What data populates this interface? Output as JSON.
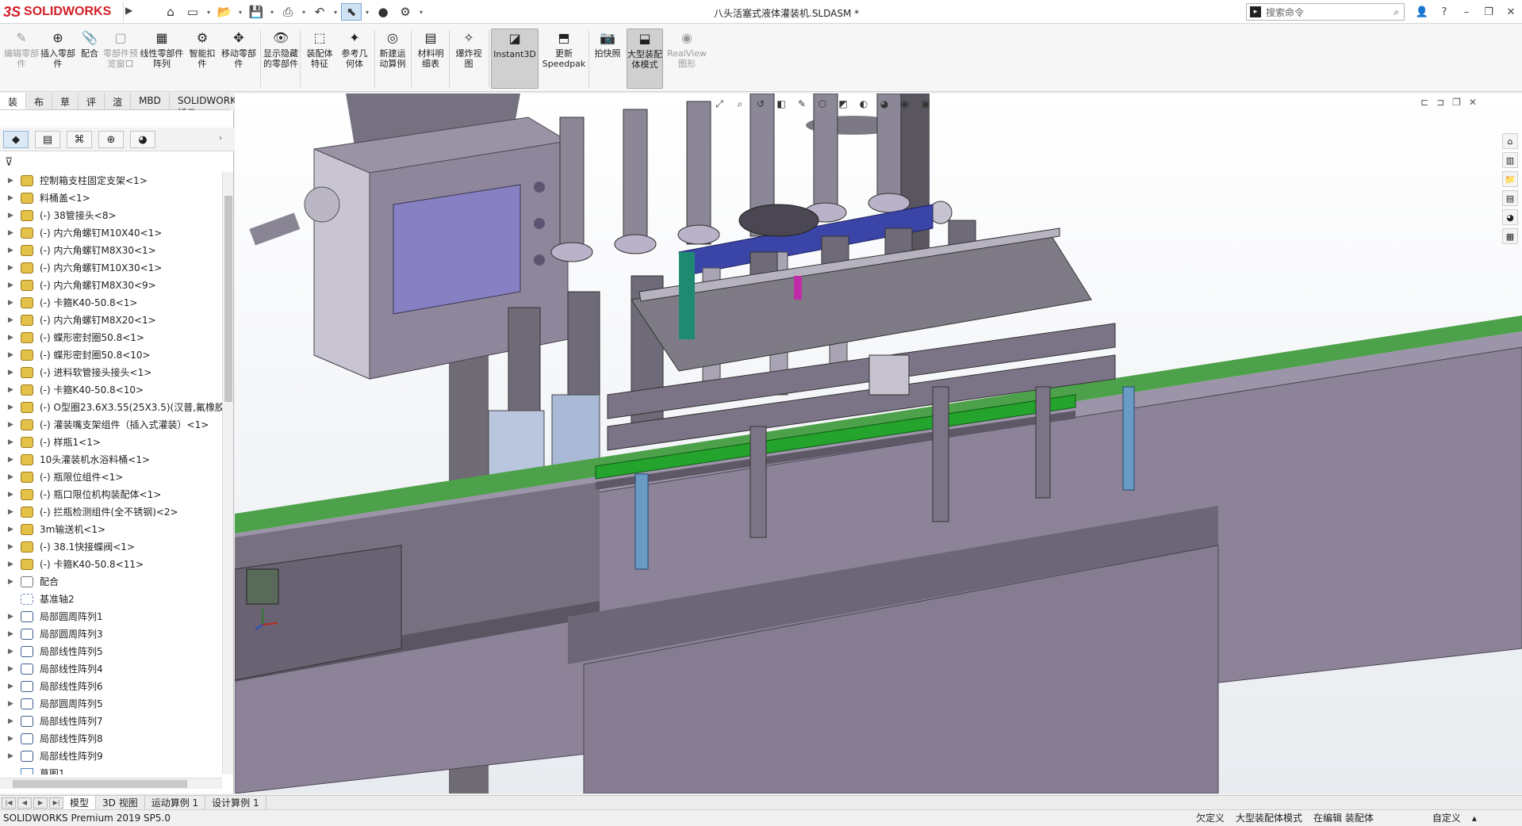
{
  "app": {
    "logo_text": "SOLIDWORKS",
    "logo_ds": "3S",
    "document_title": "八头活塞式液体灌装机.SLDASM *"
  },
  "quick_access": {
    "icons": [
      "home-icon",
      "new-icon",
      "open-icon",
      "save-icon",
      "print-icon",
      "undo-icon",
      "select-icon",
      "traffic-light-icon",
      "options-icon"
    ]
  },
  "search": {
    "placeholder": "搜索命令",
    "icon": "search-icon"
  },
  "window_controls": [
    "user-icon",
    "help-icon",
    "minimize-icon",
    "restore-icon",
    "close-icon"
  ],
  "ribbon": {
    "buttons": [
      {
        "label": "编辑零部件",
        "enabled": false
      },
      {
        "label": "插入零部件",
        "enabled": true
      },
      {
        "label": "配合",
        "enabled": true
      },
      {
        "label": "零部件预览窗口",
        "enabled": false
      },
      {
        "label": "线性零部件阵列",
        "enabled": true
      },
      {
        "label": "智能扣件",
        "enabled": true
      },
      {
        "label": "移动零部件",
        "enabled": true
      },
      {
        "label": "显示隐藏的零部件",
        "enabled": true
      },
      {
        "label": "装配体特征",
        "enabled": true
      },
      {
        "label": "参考几何体",
        "enabled": true
      },
      {
        "label": "新建运动算例",
        "enabled": true
      },
      {
        "label": "材料明细表",
        "enabled": true
      },
      {
        "label": "爆炸视图",
        "enabled": true
      },
      {
        "label": "Instant3D",
        "enabled": true
      },
      {
        "label": "更新Speedpak",
        "enabled": true
      },
      {
        "label": "拍快照",
        "enabled": true
      },
      {
        "label": "大型装配体模式",
        "enabled": true
      },
      {
        "label": "RealView图形",
        "enabled": false
      }
    ]
  },
  "command_tabs": [
    "装配体",
    "布局",
    "草图",
    "评估",
    "渲染工具",
    "MBD",
    "SOLIDWORKS 插件"
  ],
  "feature_tree": {
    "items": [
      {
        "label": "控制箱支柱固定支架<1>",
        "type": "part"
      },
      {
        "label": "料桶盖<1>",
        "type": "part"
      },
      {
        "label": "(-) 38管接头<8>",
        "type": "part"
      },
      {
        "label": "(-) 内六角螺钉M10X40<1>",
        "type": "part"
      },
      {
        "label": "(-) 内六角螺钉M8X30<1>",
        "type": "part"
      },
      {
        "label": "(-) 内六角螺钉M10X30<1>",
        "type": "part"
      },
      {
        "label": "(-) 内六角螺钉M8X30<9>",
        "type": "part"
      },
      {
        "label": "(-) 卡箍K40-50.8<1>",
        "type": "part"
      },
      {
        "label": "(-) 内六角螺钉M8X20<1>",
        "type": "part"
      },
      {
        "label": "(-) 蝶形密封圈50.8<1>",
        "type": "part"
      },
      {
        "label": "(-) 蝶形密封圈50.8<10>",
        "type": "part"
      },
      {
        "label": "(-) 进料软管接头接头<1>",
        "type": "part"
      },
      {
        "label": "(-) 卡箍K40-50.8<10>",
        "type": "part"
      },
      {
        "label": "(-) O型圈23.6X3.55(25X3.5)(汉普,氟橡胶)",
        "type": "part"
      },
      {
        "label": "(-) 灌装嘴支架组件（插入式灌装）<1>",
        "type": "part"
      },
      {
        "label": "(-) 样瓶1<1>",
        "type": "part"
      },
      {
        "label": "10头灌装机水浴料桶<1>",
        "type": "part"
      },
      {
        "label": "(-) 瓶限位组件<1>",
        "type": "part"
      },
      {
        "label": "(-) 瓶口限位机构装配体<1>",
        "type": "part"
      },
      {
        "label": "(-) 拦瓶检测组件(全不锈钢)<2>",
        "type": "part"
      },
      {
        "label": "3m输送机<1>",
        "type": "part"
      },
      {
        "label": "(-) 38.1快接蝶阀<1>",
        "type": "part"
      },
      {
        "label": "(-) 卡箍K40-50.8<11>",
        "type": "part"
      },
      {
        "label": "配合",
        "type": "mate"
      },
      {
        "label": "基准轴2",
        "type": "axis"
      },
      {
        "label": "局部圆周阵列1",
        "type": "pattern"
      },
      {
        "label": "局部圆周阵列3",
        "type": "pattern"
      },
      {
        "label": "局部线性阵列5",
        "type": "pattern"
      },
      {
        "label": "局部线性阵列4",
        "type": "pattern"
      },
      {
        "label": "局部线性阵列6",
        "type": "pattern"
      },
      {
        "label": "局部圆周阵列5",
        "type": "pattern"
      },
      {
        "label": "局部线性阵列7",
        "type": "pattern"
      },
      {
        "label": "局部线性阵列8",
        "type": "pattern"
      },
      {
        "label": "局部线性阵列9",
        "type": "pattern"
      },
      {
        "label": "草图1",
        "type": "sketch"
      }
    ]
  },
  "bottom_tabs": [
    "模型",
    "3D 视图",
    "运动算例 1",
    "设计算例 1"
  ],
  "status": {
    "left": "SOLIDWORKS Premium 2019 SP5.0",
    "right": [
      "欠定义",
      "大型装配体模式",
      "在编辑 装配体",
      "自定义"
    ]
  },
  "colors": {
    "accent": "#d21f26",
    "machine": "#8a7a98",
    "conveyor_green": "#2aa53a"
  }
}
